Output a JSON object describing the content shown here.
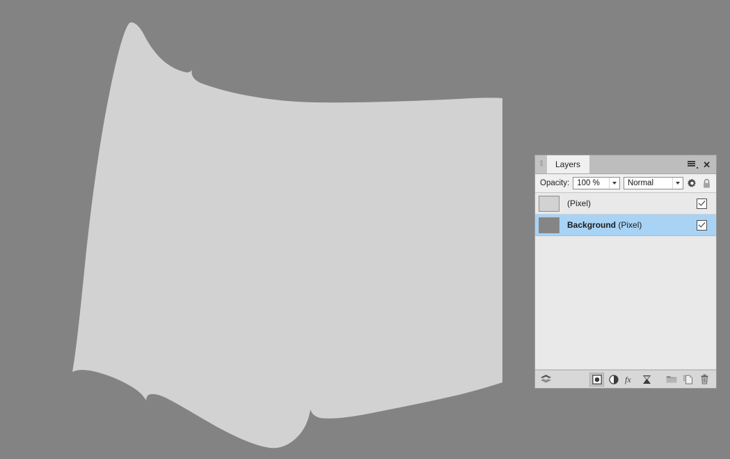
{
  "app": {
    "background_color": "#838383",
    "document_fill_color": "#d2d2d2"
  },
  "canvas": {
    "name": "image-canvas",
    "description": "Torn-paper shaped light gray pixel layer over mid-gray background"
  },
  "panel": {
    "title": "Layers",
    "grip": "⁞⁞",
    "menu_icon": "panel-menu-icon",
    "close_label": "✕",
    "options": {
      "opacity_label": "Opacity:",
      "opacity_value": "100 %",
      "blend_mode_value": "Normal",
      "blend_modes": [
        "Normal"
      ],
      "gear_icon": "gear-icon",
      "lock_icon": "lock-icon"
    },
    "layers": [
      {
        "name": "",
        "kind": "(Pixel)",
        "visible": true,
        "selected": false,
        "thumb_color": "#d2d2d2",
        "checkbox": "☑"
      },
      {
        "name": "Background",
        "kind": "(Pixel)",
        "visible": true,
        "selected": true,
        "thumb_color": "#858585",
        "checkbox": "☑"
      }
    ],
    "toolbar": {
      "left": {
        "icon": "layers-stack-icon",
        "title": "Layer effects stack"
      },
      "buttons": [
        {
          "icon": "mask-icon",
          "title": "Add pixel mask"
        },
        {
          "icon": "adjustment-icon",
          "title": "Add adjustment"
        },
        {
          "icon": "fx-icon",
          "title": "Add layer effects",
          "label": "fx"
        },
        {
          "icon": "filter-icon",
          "title": "Add live filter"
        }
      ],
      "buttons_right": [
        {
          "icon": "folder-icon",
          "title": "Add group"
        },
        {
          "icon": "new-layer-icon",
          "title": "Add pixel layer"
        },
        {
          "icon": "trash-icon",
          "title": "Delete layer"
        }
      ]
    }
  }
}
